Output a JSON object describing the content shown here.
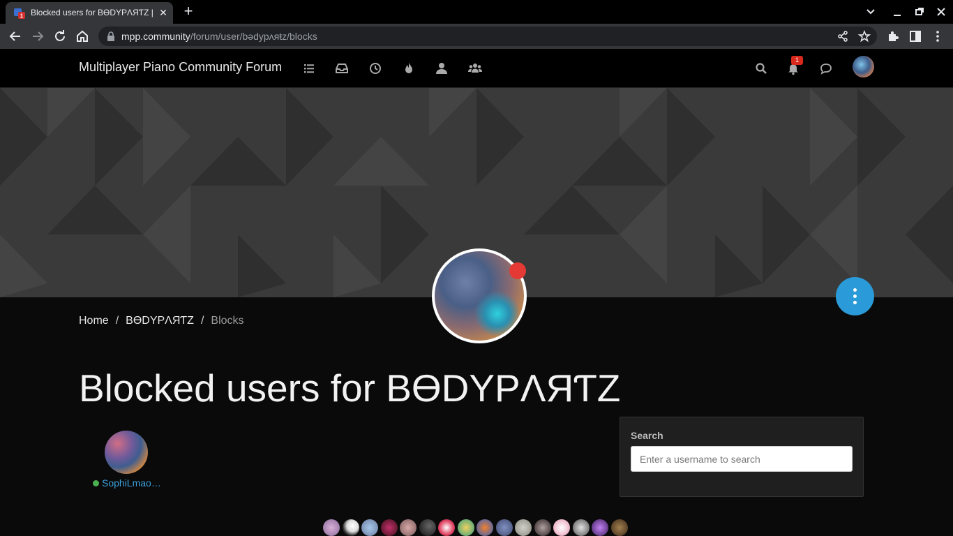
{
  "browser": {
    "tab_title": "Blocked users for BƟDYPΛЯƬZ | Multiplayer Piano Community Forum",
    "tab_close": "✕",
    "new_tab": "+",
    "url_host": "mpp.community",
    "url_path": "/forum/user/bədypʌяŧz/blocks"
  },
  "navbar": {
    "brand": "Multiplayer Piano Community Forum",
    "notification_count": "1"
  },
  "breadcrumb": {
    "home": "Home",
    "user": "BƟDYPΛЯƬZ",
    "current": "Blocks",
    "sep": "/"
  },
  "page": {
    "title": "Blocked users for BƟDYPΛЯƬZ"
  },
  "blocked_users": [
    {
      "name": "SophiLmao…",
      "online": true
    }
  ],
  "search": {
    "label": "Search",
    "placeholder": "Enter a username to search"
  },
  "colors": {
    "accent": "#2b9ad8",
    "link": "#3ca0dc",
    "status_away": "#e53935",
    "online": "#4caf50"
  },
  "online_users_count": 16
}
